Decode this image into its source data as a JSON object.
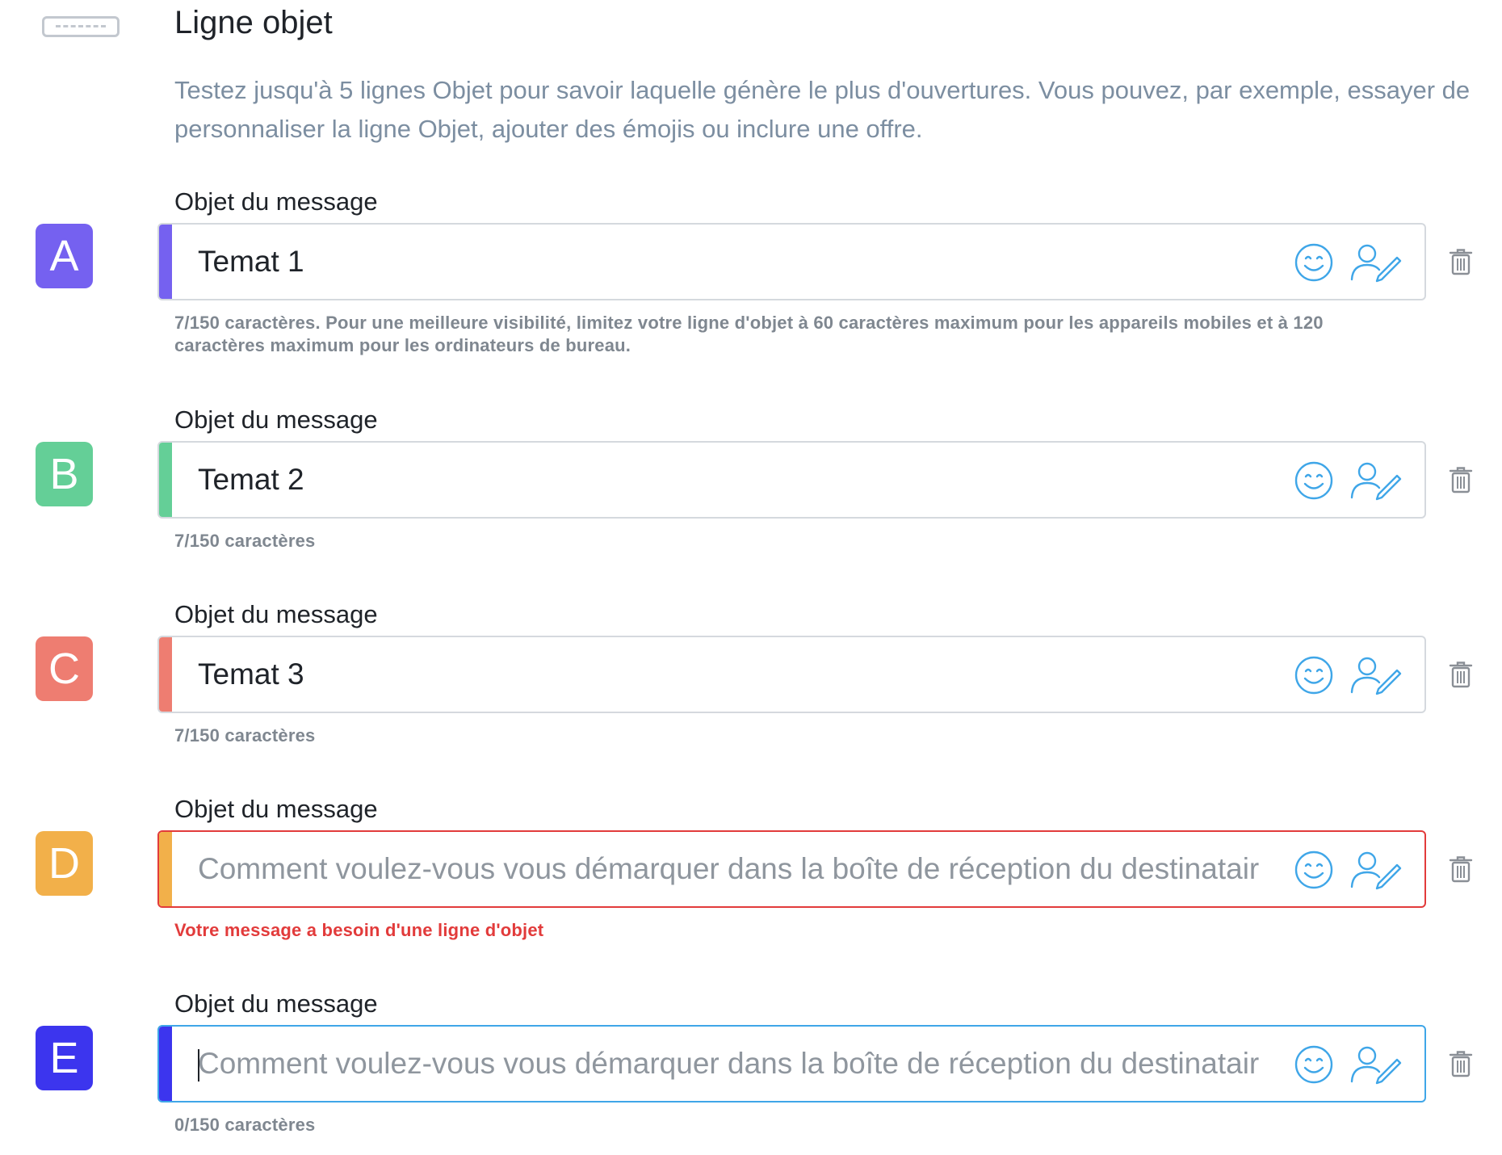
{
  "section": {
    "title": "Ligne objet",
    "description": "Testez jusqu'à 5 lignes Objet pour savoir laquelle génère le plus d'ouvertures. Vous pouvez, par exemple, essayer de personnaliser la ligne Objet, ajouter des émojis ou inclure une offre.",
    "icon": "subject-line-icon"
  },
  "colors": {
    "a": "#7561f0",
    "b": "#64cf97",
    "c": "#ee7d71",
    "d": "#f2b04a",
    "e": "#3c35ee",
    "icon_blue": "#3fa6e8",
    "error_red": "#e23b3b"
  },
  "variants": [
    {
      "letter": "A",
      "label": "Objet du message",
      "value": "Temat 1",
      "placeholder": "",
      "helper": "7/150 caractères. Pour une meilleure visibilité, limitez votre ligne d'objet à 60 caractères maximum pour les appareils mobiles et à 120 caractères maximum pour les ordinateurs de bureau.",
      "state": "filled"
    },
    {
      "letter": "B",
      "label": "Objet du message",
      "value": "Temat 2",
      "placeholder": "",
      "helper": "7/150 caractères",
      "state": "filled"
    },
    {
      "letter": "C",
      "label": "Objet du message",
      "value": "Temat 3",
      "placeholder": "",
      "helper": "7/150 caractères",
      "state": "filled"
    },
    {
      "letter": "D",
      "label": "Objet du message",
      "value": "",
      "placeholder": "Comment voulez-vous vous démarquer dans la boîte de réception du destinatair",
      "helper": "Votre message a besoin d'une ligne d'objet",
      "state": "error"
    },
    {
      "letter": "E",
      "label": "Objet du message",
      "value": "",
      "placeholder": "Comment voulez-vous vous démarquer dans la boîte de réception du destinatair",
      "helper": "0/150 caractères",
      "state": "focused"
    }
  ]
}
